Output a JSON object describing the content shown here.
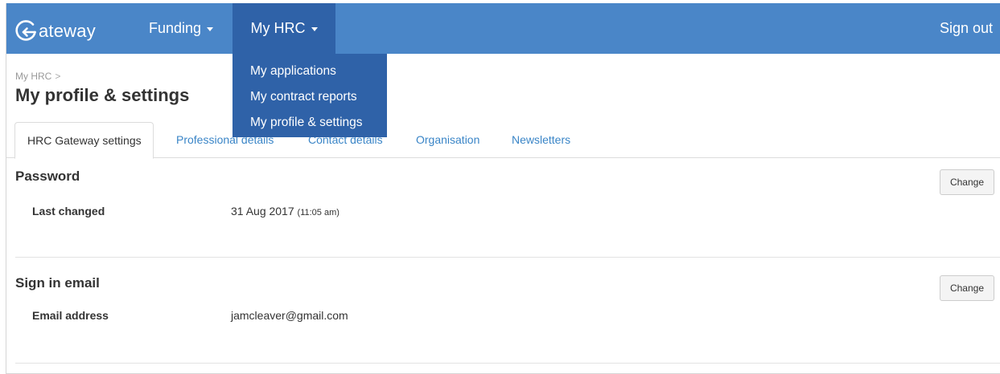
{
  "navbar": {
    "brand": "ateway",
    "brand_letter": "G",
    "funding_label": "Funding",
    "myhrc_label": "My HRC",
    "signout_label": "Sign out"
  },
  "dropdown": {
    "items": [
      {
        "label": "My applications"
      },
      {
        "label": "My contract reports"
      },
      {
        "label": "My profile & settings"
      }
    ]
  },
  "breadcrumb": {
    "parent": "My HRC",
    "separator": ">"
  },
  "page": {
    "title": "My profile & settings"
  },
  "tabs": [
    {
      "label": "HRC Gateway settings",
      "active": true
    },
    {
      "label": "Professional details",
      "active": false
    },
    {
      "label": "Contact details",
      "active": false
    },
    {
      "label": "Organisation",
      "active": false
    },
    {
      "label": "Newsletters",
      "active": false
    }
  ],
  "password_section": {
    "title": "Password",
    "change_label": "Change",
    "last_changed_label": "Last changed",
    "last_changed_date": "31 Aug 2017",
    "last_changed_time": "(11:05 am)"
  },
  "email_section": {
    "title": "Sign in email",
    "change_label": "Change",
    "email_label": "Email address",
    "email_value": "jamcleaver@gmail.com"
  },
  "colors": {
    "navbar": "#4a86c8",
    "navbar_active": "#2f62a8",
    "link": "#3a85c7"
  }
}
